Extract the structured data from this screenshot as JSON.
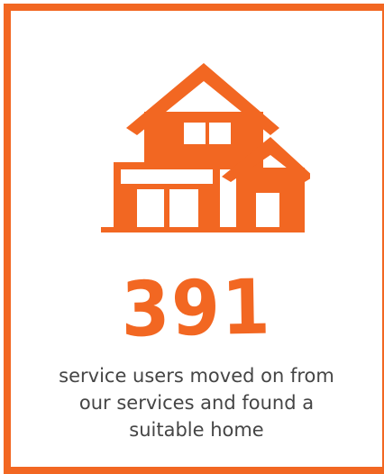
{
  "accent_color": "#f26722",
  "text_color": "#454545",
  "icon": "house-icon",
  "stat": {
    "value": "391"
  },
  "caption": {
    "lines": [
      "service users moved on from",
      "our services and found a",
      "suitable home"
    ]
  }
}
